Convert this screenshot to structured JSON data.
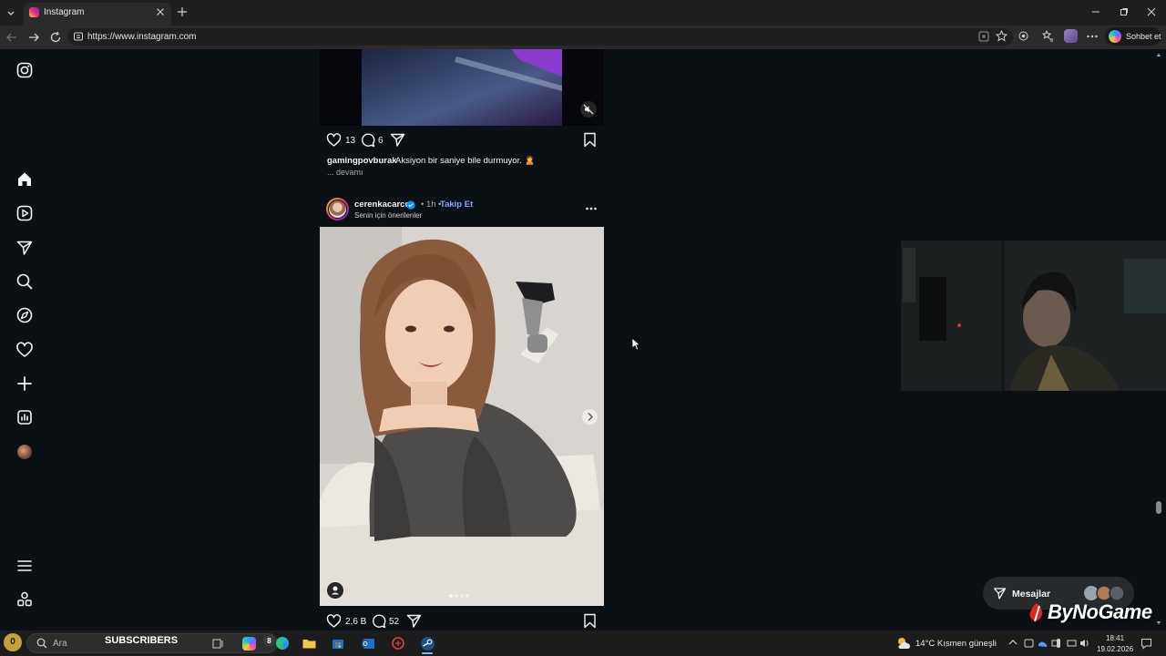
{
  "browser": {
    "tab_title": "Instagram",
    "url": "https://www.instagram.com",
    "copilot_label": "Sohbet et"
  },
  "prev_post": {
    "likes": "13",
    "comments": "6",
    "caption_user": "gamingpovburak",
    "caption_text": "Aksiyon bir saniye bile durmuyor. 🙎",
    "more": "... devamı"
  },
  "post": {
    "username": "cerenkacarcc",
    "time": "• 1h •",
    "follow": "Takip Et",
    "suggested": "Senin için önerilenler",
    "likes": "2,6 B",
    "comments": "52"
  },
  "messages": {
    "label": "Mesajlar"
  },
  "watermark": {
    "text": "ByNoGame"
  },
  "taskbar": {
    "badge": "0",
    "search_placeholder": "Ara",
    "subscribers": "SUBSCRIBERS",
    "notif_count": "8",
    "weather": "14°C  Kısmen güneşli",
    "time": "18:41",
    "date": "19.02.2026"
  },
  "colors": {
    "accent_link": "#85a1ff",
    "verified": "#0095f6",
    "page_bg": "#0b1014"
  }
}
